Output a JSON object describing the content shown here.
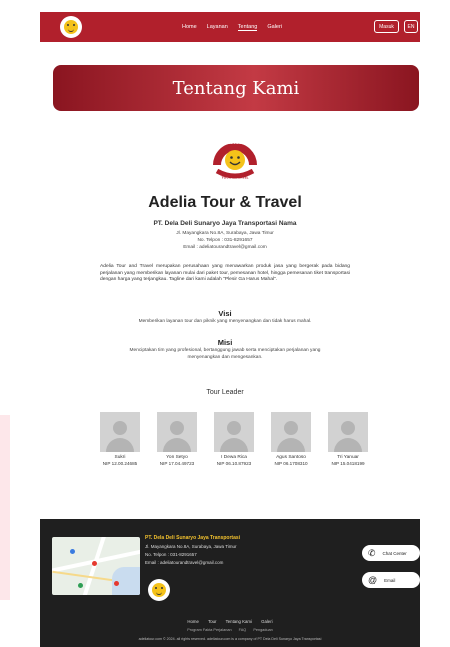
{
  "header": {
    "nav": [
      "Home",
      "Layanan",
      "Tentang",
      "Galeri"
    ],
    "active_nav": "Tentang",
    "login_label": "Masuk",
    "lang_label": "EN"
  },
  "banner": {
    "title": "Tentang Kami"
  },
  "company": {
    "logo_text_top": "ADELIA",
    "logo_text_bottom": "TOUR & TRAVEL",
    "name": "Adelia Tour & Travel",
    "legal_name": "PT. Dela Deli Sunaryo Jaya Transportasi Nama",
    "address": "Jl. Mayangkara No.8A, Surabaya, Jawa Timur",
    "phone": "No. Telpon : 031-8291657",
    "email": "Email : adeliatourandtravel@gmail.com",
    "about": "Adelia Tour and Travel merupakan perusahaan yang menawarkan produk jasa yang bergerak pada bidang perjalanan yang memberikan layanan mulai dari paket tour, pemesanan hotel, hingga pemesanan tiket transportasi dengan harga yang terjangkau. Tagline dari kami adalah \"Plesir Ga Harus Mahal\"."
  },
  "visi": {
    "title": "Visi",
    "text": "Memberikan layanan tour dan piknik yang menyenangkan dan tidak harus mahal."
  },
  "misi": {
    "title": "Misi",
    "text": "Menciptakan tim yang profesional, bertanggung jawab serta menciptakan perjalanan yang menyenangkan dan mengesankan."
  },
  "tour_leader": {
    "title": "Tour Leader",
    "leaders": [
      {
        "name": "Sukri",
        "nip": "NIP 12.00.24685"
      },
      {
        "name": "Yon Setyo",
        "nip": "NIP 17.04.49723"
      },
      {
        "name": "I Dewa Rica",
        "nip": "NIP 06.10.87923"
      },
      {
        "name": "Agus Santoso",
        "nip": "NIP 06.1708310"
      },
      {
        "name": "Tri Yanuar",
        "nip": "NIP 15.0418199"
      }
    ]
  },
  "footer": {
    "company": "PT. Dela Deli Sunaryo Jaya Transportasi",
    "address": "Jl. Mayangkara No.8A, Surabaya, Jawa Timur",
    "phone": "No. Telpon : 031-8291657",
    "email": "Email : adeliatourandtravel@gmail.com",
    "chat_label": "Chat Center",
    "email_label": "Email",
    "links": [
      "Home",
      "Tour",
      "Tentang Kami",
      "Galeri"
    ],
    "links2": [
      "Program Fakta Perjalanan",
      "FAQ",
      "Pengaduan"
    ],
    "copyright": "adeliatour.com © 2024. all rights reserved. adeliatour.com is a company of PT Dela Deli Sunaryo Jaya Transportasi"
  },
  "colors": {
    "brand_red": "#b1202c",
    "footer_bg": "#1f1f1f",
    "accent_yellow": "#f2c12e"
  }
}
